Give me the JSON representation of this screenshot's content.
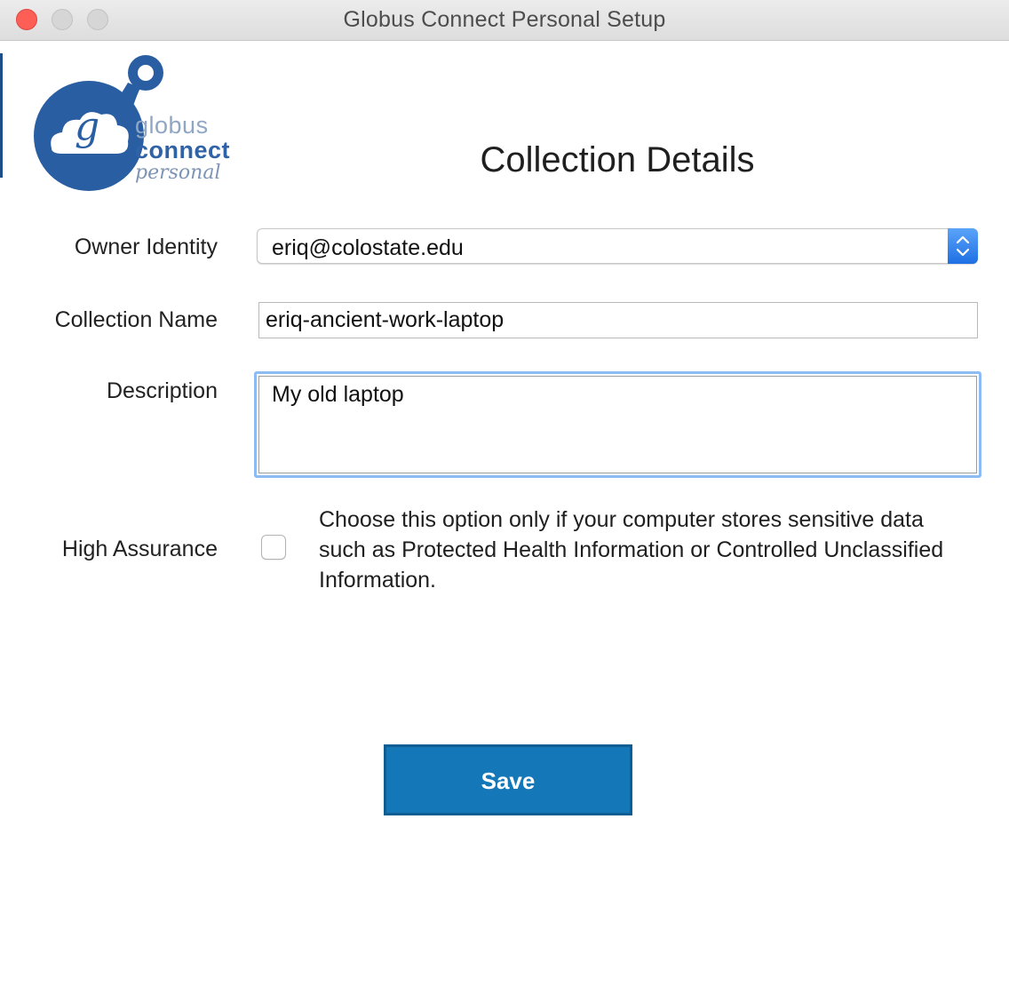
{
  "window": {
    "title": "Globus Connect Personal Setup"
  },
  "logo": {
    "line1": "globus",
    "line2": "connect",
    "line3": "personal",
    "mark_letter": "g"
  },
  "page": {
    "heading": "Collection Details"
  },
  "form": {
    "owner_identity": {
      "label": "Owner Identity",
      "value": "eriq@colostate.edu"
    },
    "collection_name": {
      "label": "Collection Name",
      "value": "eriq-ancient-work-laptop"
    },
    "description": {
      "label": "Description",
      "value": "My old laptop"
    },
    "high_assurance": {
      "label": "High Assurance",
      "checked": false,
      "help_text": "Choose this option only if your computer stores sensitive data such as Protected Health Information or Controlled Unclassified Information."
    }
  },
  "actions": {
    "save_label": "Save"
  },
  "colors": {
    "accent": "#1477b8",
    "logo_blue": "#2a5ea3",
    "focus_ring": "#8cbcf3",
    "close_button": "#fd5f57"
  }
}
